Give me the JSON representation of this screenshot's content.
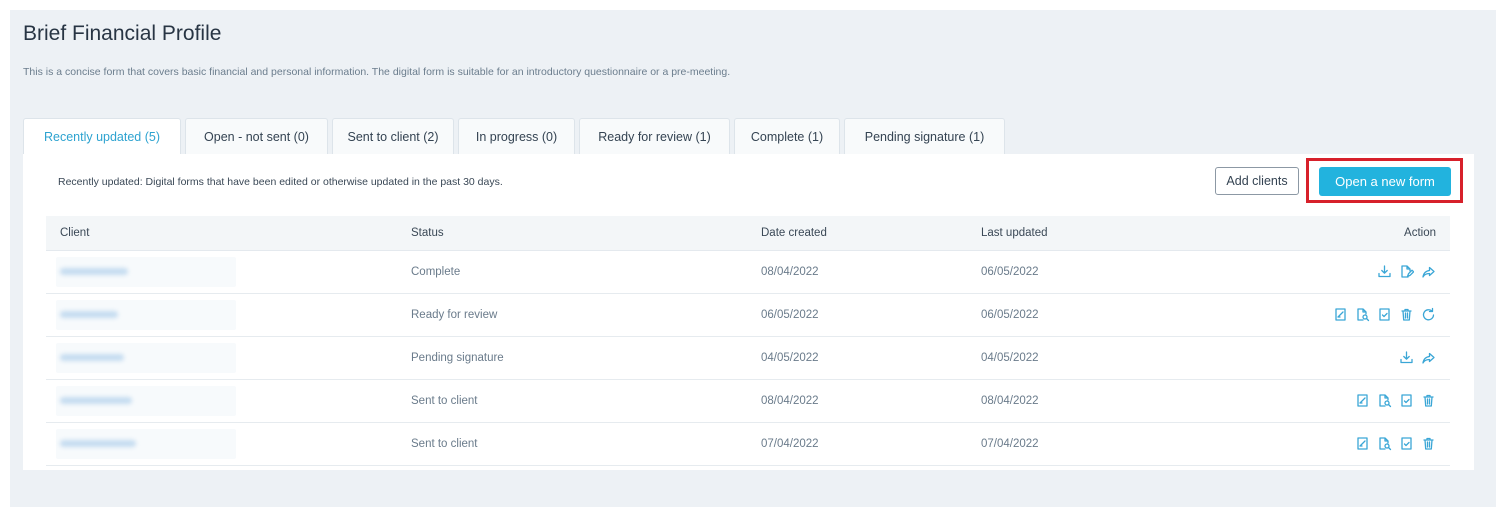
{
  "page": {
    "title": "Brief Financial Profile",
    "subtitle": "This is a concise form that covers basic financial and personal information. The digital form is suitable for an introductory questionnaire or a pre-meeting."
  },
  "tabs": [
    {
      "label": "Recently updated (5)",
      "active": true
    },
    {
      "label": "Open - not sent (0)",
      "active": false
    },
    {
      "label": "Sent to client (2)",
      "active": false
    },
    {
      "label": "In progress (0)",
      "active": false
    },
    {
      "label": "Ready for review (1)",
      "active": false
    },
    {
      "label": "Complete (1)",
      "active": false
    },
    {
      "label": "Pending signature (1)",
      "active": false
    }
  ],
  "panel": {
    "description": "Recently updated: Digital forms that have been edited or otherwise updated in the past 30 days.",
    "add_clients_label": "Add clients",
    "open_form_label": "Open a new form"
  },
  "table": {
    "headers": {
      "client": "Client",
      "status": "Status",
      "date_created": "Date created",
      "last_updated": "Last updated",
      "action": "Action"
    },
    "rows": [
      {
        "status": "Complete",
        "date_created": "08/04/2022",
        "last_updated": "06/05/2022",
        "actions": [
          "download-icon",
          "edit-document-icon",
          "share-icon"
        ]
      },
      {
        "status": "Ready for review",
        "date_created": "06/05/2022",
        "last_updated": "06/05/2022",
        "actions": [
          "sign-document-icon",
          "preview-document-icon",
          "approve-document-icon",
          "trash-icon",
          "refresh-icon"
        ]
      },
      {
        "status": "Pending signature",
        "date_created": "04/05/2022",
        "last_updated": "04/05/2022",
        "actions": [
          "download-icon",
          "share-icon"
        ]
      },
      {
        "status": "Sent to client",
        "date_created": "08/04/2022",
        "last_updated": "08/04/2022",
        "actions": [
          "sign-document-icon",
          "preview-document-icon",
          "approve-document-icon",
          "trash-icon"
        ]
      },
      {
        "status": "Sent to client",
        "date_created": "07/04/2022",
        "last_updated": "07/04/2022",
        "actions": [
          "sign-document-icon",
          "preview-document-icon",
          "approve-document-icon",
          "trash-icon"
        ]
      }
    ]
  },
  "colors": {
    "accent": "#22b3de",
    "highlight": "#d7202a",
    "icon": "#3aa6d6"
  }
}
